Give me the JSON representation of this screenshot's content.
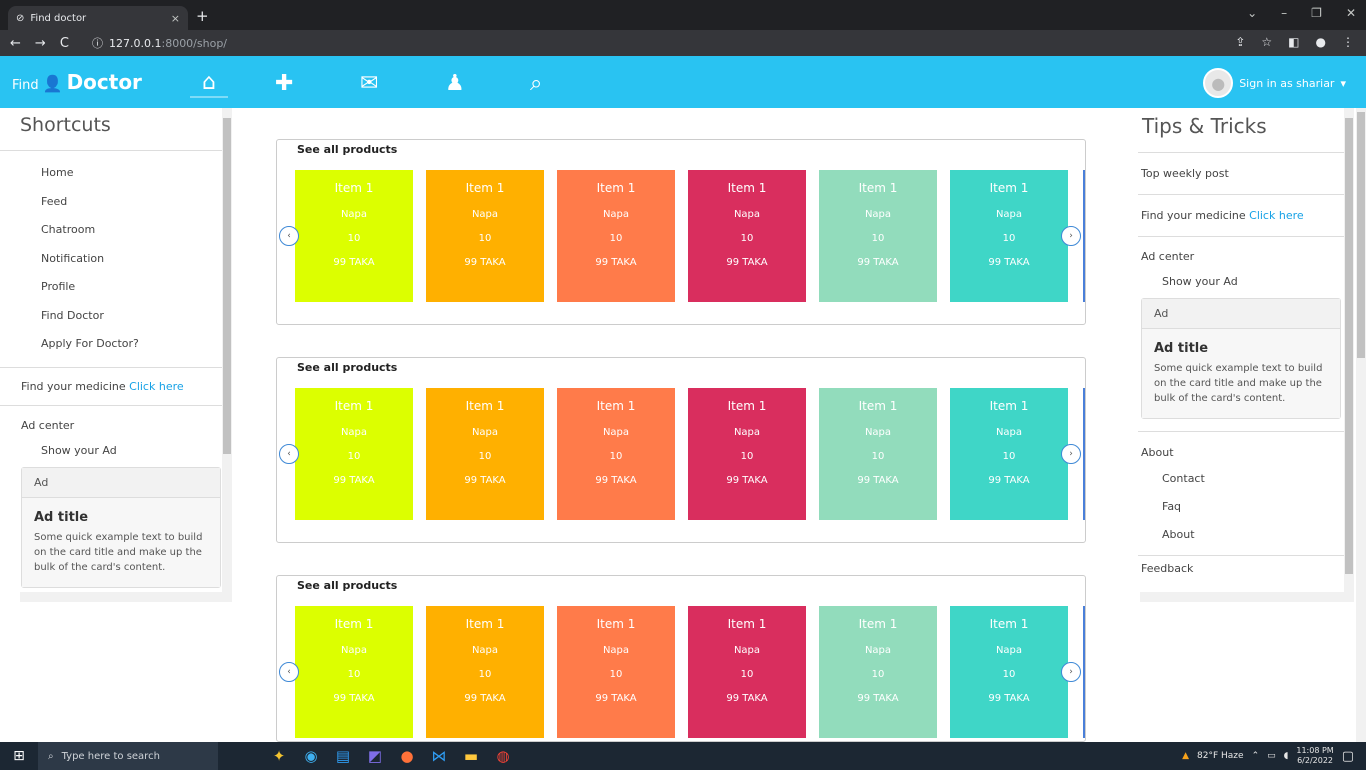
{
  "browser": {
    "tab_title": "Find doctor",
    "tab_close": "×",
    "new_tab": "+",
    "url_host": "127.0.0.1",
    "url_path": ":8000/shop/",
    "window_controls": [
      "⌄",
      "–",
      "❐",
      "✕"
    ]
  },
  "navbar": {
    "brand_prefix": "Find",
    "brand_name": "Doctor",
    "nav_icons": [
      "home-icon",
      "medkit-icon",
      "envelope-icon",
      "doctor-icon",
      "search-icon"
    ],
    "signin_label": "Sign in as shariar",
    "accent_color": "#29c3f2"
  },
  "left_sidebar": {
    "title": "Shortcuts",
    "items": [
      "Home",
      "Feed",
      "Chatroom",
      "Notification",
      "Profile",
      "Find Doctor",
      "Apply For Doctor?"
    ],
    "medicine_text": "Find your medicine",
    "medicine_link": "Click here",
    "ad_center": "Ad center",
    "show_ad": "Show your Ad",
    "card_header": "Ad",
    "card_title": "Ad title",
    "card_text": "Some quick example text to build on the card title and make up the bulk of the card's content."
  },
  "right_sidebar": {
    "title": "Tips & Tricks",
    "top_weekly": "Top weekly post",
    "medicine_text": "Find your medicine",
    "medicine_link": "Click here",
    "ad_center": "Ad center",
    "show_ad": "Show your Ad",
    "card_header": "Ad",
    "card_title": "Ad title",
    "card_text": "Some quick example text to build on the card title and make up the bulk of the card's content.",
    "about_title": "About",
    "about_items": [
      "Contact",
      "Faq",
      "About"
    ],
    "feedback": "Feedback"
  },
  "sections": [
    {
      "title": "See all products"
    },
    {
      "title": "See all products"
    },
    {
      "title": "See all products"
    }
  ],
  "product": {
    "name": "Item 1",
    "drug": "Napa",
    "qty": "10",
    "price": "99 TAKA"
  },
  "product_colors": [
    "#dcff00",
    "#ffb000",
    "#ff7b4a",
    "#d92e5e",
    "#92dcbc",
    "#3fd6c7"
  ],
  "taskbar": {
    "search_placeholder": "Type here to search",
    "weather": "82°F Haze",
    "time": "11:08 PM",
    "date": "6/2/2022"
  }
}
